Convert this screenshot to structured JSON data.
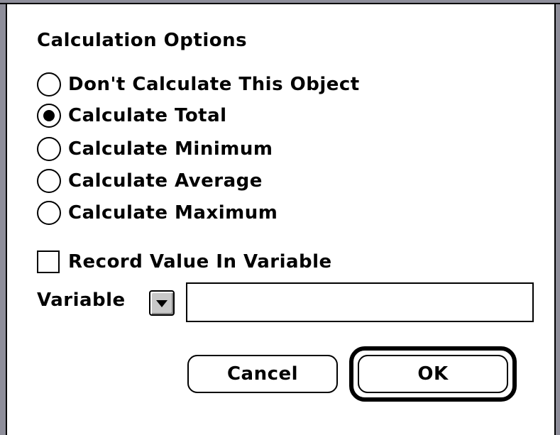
{
  "dialog": {
    "title": "Calculation Options",
    "options": [
      {
        "label": "Don't Calculate This Object",
        "selected": false
      },
      {
        "label": "Calculate Total",
        "selected": true
      },
      {
        "label": "Calculate Minimum",
        "selected": false
      },
      {
        "label": "Calculate Average",
        "selected": false
      },
      {
        "label": "Calculate Maximum",
        "selected": false
      }
    ],
    "record_checkbox": {
      "label": "Record Value In Variable",
      "checked": false
    },
    "variable": {
      "label": "Variable",
      "value": "",
      "popup_icon": "chevron-down-icon"
    },
    "buttons": {
      "cancel": "Cancel",
      "ok": "OK"
    }
  },
  "colors": {
    "frame": "#8e8e9a",
    "popup_button": "#c8c8c8"
  }
}
